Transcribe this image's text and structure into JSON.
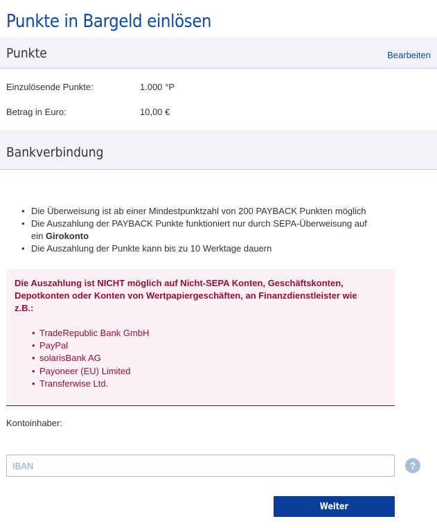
{
  "page": {
    "title": "Punkte in Bargeld einlösen"
  },
  "points_section": {
    "heading": "Punkte",
    "edit_label": "Bearbeiten",
    "rows": [
      {
        "label": "Einzulösende Punkte:",
        "value": "1.000 °P"
      },
      {
        "label": "Betrag in Euro:",
        "value": "10,00 €"
      }
    ]
  },
  "bank_section": {
    "heading": "Bankverbindung",
    "info": [
      {
        "text": "Die Überweisung ist ab einer Mindestpunktzahl von 200 PAYBACK Punkten möglich"
      },
      {
        "text": "Die Auszahlung der PAYBACK Punkte funktioniert nur durch SEPA-Überweisung auf ein ",
        "bold": "Girokonto"
      },
      {
        "text": "Die Auszahlung der Punkte kann bis zu 10 Werktage dauern"
      }
    ],
    "warning": {
      "text": "Die Auszahlung ist NICHT möglich auf Nicht-SEPA Konten, Geschäftskonten, Depotkonten oder Konten von Wertpapiergeschäften, an Finanzdienstleister wie z.B.:",
      "items": [
        "TradeRepublic Bank GmbH",
        "PayPal",
        "solarisBank AG",
        "Payoneer (EU) Limited",
        "Transferwise Ltd."
      ]
    },
    "holder_label": "Kontoinhaber:",
    "iban_placeholder": "IBAN",
    "iban_value": "",
    "help_glyph": "?",
    "submit_label": "Weiter"
  },
  "colors": {
    "brand_blue": "#0a4aa0",
    "button_blue": "#0a3d99",
    "warning_text": "#8c1238",
    "warning_bg": "#fdf1f4",
    "section_bg": "#f2f4f7"
  },
  "icons": {
    "help": "question-circle-icon"
  }
}
